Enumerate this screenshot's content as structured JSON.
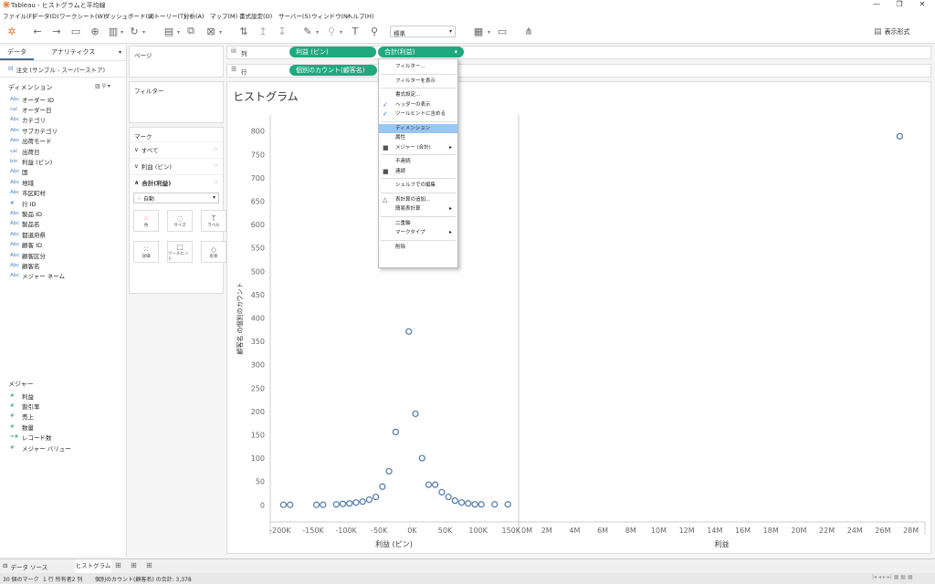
{
  "window": {
    "title": "Tableau - ヒストグラムと平均線"
  },
  "menu": [
    "ファイル(F)",
    "データ(D)",
    "ワークシート(W)",
    "ダッシュボード(B)",
    "ストーリー(T)",
    "分析(A)",
    "マップ(M)",
    "書式設定(O)",
    "サーバー(S)",
    "ウィンドウ(N)",
    "ヘルプ(H)"
  ],
  "toolbar": {
    "fit_value": "標準",
    "present_label": "表示形式"
  },
  "data_pane": {
    "tab_data": "データ",
    "tab_analytics": "アナリティクス",
    "datasource": "注文 (サンプル - スーパーストア)",
    "dimensions_header": "ディメンション",
    "dimensions": [
      {
        "icon": "Abc",
        "label": "オーダー ID"
      },
      {
        "icon": "cal",
        "label": "オーダー日"
      },
      {
        "icon": "Abc",
        "label": "カテゴリ"
      },
      {
        "icon": "Abc",
        "label": "サブカテゴリ"
      },
      {
        "icon": "Abc",
        "label": "出荷モード"
      },
      {
        "icon": "cal",
        "label": "出荷日"
      },
      {
        "icon": "bin",
        "label": "利益 (ビン)"
      },
      {
        "icon": "Abc",
        "label": "国"
      },
      {
        "icon": "Abc",
        "label": "地域"
      },
      {
        "icon": "Abc",
        "label": "市区町村"
      },
      {
        "icon": "#",
        "label": "行 ID"
      },
      {
        "icon": "Abc",
        "label": "製品 ID"
      },
      {
        "icon": "Abc",
        "label": "製品名"
      },
      {
        "icon": "Abc",
        "label": "都道府県"
      },
      {
        "icon": "Abc",
        "label": "顧客 ID"
      },
      {
        "icon": "Abc",
        "label": "顧客区分"
      },
      {
        "icon": "Abc",
        "label": "顧客名"
      },
      {
        "icon": "Abc",
        "label": "メジャー ネーム"
      }
    ],
    "measures_header": "メジャー",
    "measures": [
      {
        "icon": "#",
        "label": "利益"
      },
      {
        "icon": "#",
        "label": "割引率"
      },
      {
        "icon": "#",
        "label": "売上"
      },
      {
        "icon": "#",
        "label": "数量"
      },
      {
        "icon": "=#",
        "label": "レコード数"
      },
      {
        "icon": "#",
        "label": "メジャー バリュー"
      }
    ]
  },
  "pages_card": {
    "title": "ページ"
  },
  "filters_card": {
    "title": "フィルター"
  },
  "marks_card": {
    "title": "マーク",
    "rows": [
      "すべて",
      "利益 (ビン)",
      "合計(利益)"
    ],
    "mark_type": "自動",
    "buttons": [
      "色",
      "サイズ",
      "ラベル",
      "詳細",
      "ツールヒント",
      "形状"
    ]
  },
  "shelves": {
    "columns_label": "列",
    "rows_label": "行",
    "columns_pills": [
      "利益 (ビン)",
      "合計(利益)"
    ],
    "rows_pills": [
      "個別のカウント(顧客名)"
    ]
  },
  "sheet": {
    "title": "ヒストグラム"
  },
  "context_menu": [
    {
      "label": "フィルター...",
      "check": "",
      "sub": false,
      "hl": false
    },
    {
      "sep": true
    },
    {
      "label": "フィルターを表示",
      "check": "",
      "sub": false,
      "hl": false
    },
    {
      "sep": true
    },
    {
      "label": "書式設定...",
      "check": "",
      "sub": false,
      "hl": false
    },
    {
      "label": "ヘッダーの表示",
      "check": "✓",
      "sub": false,
      "hl": false
    },
    {
      "label": "ツールヒントに含める",
      "check": "✓",
      "sub": false,
      "hl": false
    },
    {
      "sep": true
    },
    {
      "label": "ディメンション",
      "check": "",
      "sub": false,
      "hl": true
    },
    {
      "label": "属性",
      "check": "",
      "sub": false,
      "hl": false
    },
    {
      "label": "メジャー (合計)",
      "check": "■",
      "sub": true,
      "hl": false
    },
    {
      "sep": true
    },
    {
      "label": "不連続",
      "check": "",
      "sub": false,
      "hl": false
    },
    {
      "label": "連続",
      "check": "■",
      "sub": false,
      "hl": false
    },
    {
      "sep": true
    },
    {
      "label": "シェルフでの編集",
      "check": "",
      "sub": false,
      "hl": false
    },
    {
      "sep": true
    },
    {
      "label": "表計算の追加...",
      "check": "△",
      "sub": false,
      "hl": false
    },
    {
      "label": "簡易表計算",
      "check": "",
      "sub": true,
      "hl": false
    },
    {
      "sep": true
    },
    {
      "label": "二重軸",
      "check": "",
      "sub": false,
      "hl": false
    },
    {
      "label": "マークタイプ",
      "check": "",
      "sub": true,
      "hl": false
    },
    {
      "sep": true
    },
    {
      "label": "削除",
      "check": "",
      "sub": false,
      "hl": false
    }
  ],
  "bottom_tabs": {
    "datasource": "データ ソース",
    "sheet": "ヒストグラム"
  },
  "status": {
    "marks": "30 個のマーク",
    "rowscols": "1 行 所有者2 列",
    "sum": "個別のカウント(顧客名) の合計: 3,378"
  },
  "chart_data": [
    {
      "type": "scatter",
      "xlabel": "利益 (ビン)",
      "ylabel": "顧客名 の個別のカウント",
      "xlim": [
        -215000,
        160000
      ],
      "ylim": [
        -20,
        820
      ],
      "x_ticks": [
        "-200K",
        "-150K",
        "-100K",
        "-50K",
        "0K",
        "50K",
        "100K",
        "150K"
      ],
      "x_tick_values": [
        -200000,
        -150000,
        -100000,
        -50000,
        0,
        50000,
        100000,
        150000
      ],
      "y_ticks": [
        "0",
        "50",
        "100",
        "150",
        "200",
        "250",
        "300",
        "350",
        "400",
        "450",
        "500",
        "550",
        "600",
        "650",
        "700",
        "750",
        "800"
      ],
      "y_tick_values": [
        0,
        50,
        100,
        150,
        200,
        250,
        300,
        350,
        400,
        450,
        500,
        550,
        600,
        650,
        700,
        750,
        800
      ],
      "points": [
        [
          -195000,
          1
        ],
        [
          -185000,
          1
        ],
        [
          -145000,
          1
        ],
        [
          -135000,
          1
        ],
        [
          -115000,
          2
        ],
        [
          -105000,
          3
        ],
        [
          -95000,
          4
        ],
        [
          -85000,
          6
        ],
        [
          -75000,
          8
        ],
        [
          -65000,
          12
        ],
        [
          -55000,
          18
        ],
        [
          -45000,
          40
        ],
        [
          -35000,
          73
        ],
        [
          -25000,
          157
        ],
        [
          -5000,
          372
        ],
        [
          5000,
          196
        ],
        [
          15000,
          101
        ],
        [
          25000,
          44
        ],
        [
          35000,
          44
        ],
        [
          45000,
          28
        ],
        [
          55000,
          18
        ],
        [
          65000,
          10
        ],
        [
          75000,
          6
        ],
        [
          85000,
          4
        ],
        [
          95000,
          2
        ],
        [
          105000,
          2
        ],
        [
          125000,
          2
        ],
        [
          145000,
          2
        ]
      ]
    },
    {
      "type": "scatter",
      "xlabel": "利益",
      "xlim": [
        0,
        29000000
      ],
      "ylim": [
        -20,
        820
      ],
      "x_ticks": [
        "0M",
        "2M",
        "4M",
        "6M",
        "8M",
        "10M",
        "12M",
        "14M",
        "16M",
        "18M",
        "20M",
        "22M",
        "24M",
        "26M",
        "28M"
      ],
      "x_tick_values": [
        0,
        2000000,
        4000000,
        6000000,
        8000000,
        10000000,
        12000000,
        14000000,
        16000000,
        18000000,
        20000000,
        22000000,
        24000000,
        26000000,
        28000000
      ],
      "points": [
        [
          27200000,
          790
        ]
      ]
    }
  ],
  "colors": {
    "pill": "#1fa97d",
    "point": "#4e79a7",
    "highlight": "#99c6f2"
  }
}
